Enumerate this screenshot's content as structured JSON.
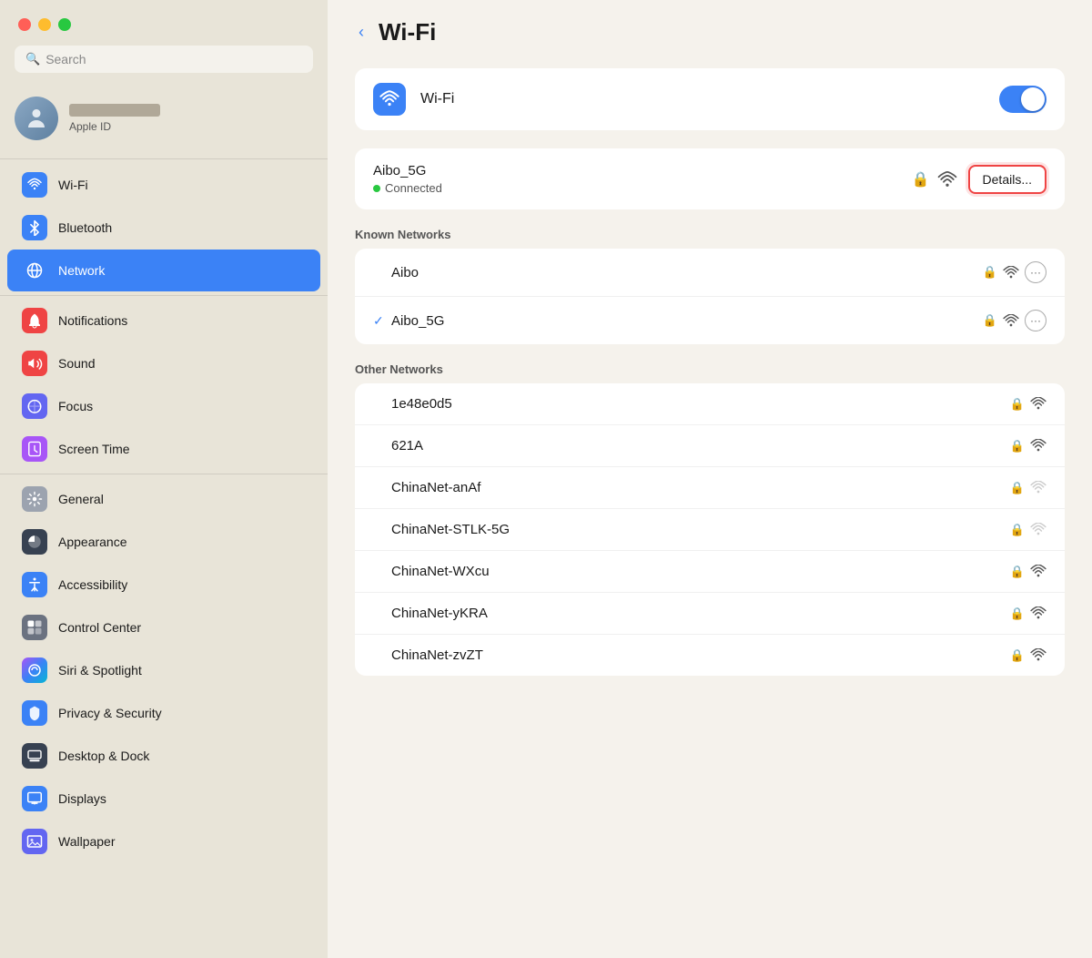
{
  "window": {
    "title": "Wi-Fi"
  },
  "window_controls": {
    "red_label": "close",
    "yellow_label": "minimize",
    "green_label": "maximize"
  },
  "sidebar": {
    "search_placeholder": "Search",
    "apple_id_label": "Apple ID",
    "items": [
      {
        "id": "wifi",
        "label": "Wi-Fi",
        "icon_type": "wifi",
        "active": false
      },
      {
        "id": "bluetooth",
        "label": "Bluetooth",
        "icon_type": "bluetooth",
        "active": false
      },
      {
        "id": "network",
        "label": "Network",
        "icon_type": "network",
        "active": true
      },
      {
        "id": "notifications",
        "label": "Notifications",
        "icon_type": "notifications",
        "active": false
      },
      {
        "id": "sound",
        "label": "Sound",
        "icon_type": "sound",
        "active": false
      },
      {
        "id": "focus",
        "label": "Focus",
        "icon_type": "focus",
        "active": false
      },
      {
        "id": "screentime",
        "label": "Screen Time",
        "icon_type": "screentime",
        "active": false
      },
      {
        "id": "general",
        "label": "General",
        "icon_type": "general",
        "active": false
      },
      {
        "id": "appearance",
        "label": "Appearance",
        "icon_type": "appearance",
        "active": false
      },
      {
        "id": "accessibility",
        "label": "Accessibility",
        "icon_type": "accessibility",
        "active": false
      },
      {
        "id": "controlcenter",
        "label": "Control Center",
        "icon_type": "controlcenter",
        "active": false
      },
      {
        "id": "siri",
        "label": "Siri & Spotlight",
        "icon_type": "siri",
        "active": false
      },
      {
        "id": "privacy",
        "label": "Privacy & Security",
        "icon_type": "privacy",
        "active": false
      },
      {
        "id": "desktopdock",
        "label": "Desktop & Dock",
        "icon_type": "desktopdock",
        "active": false
      },
      {
        "id": "displays",
        "label": "Displays",
        "icon_type": "displays",
        "active": false
      },
      {
        "id": "wallpaper",
        "label": "Wallpaper",
        "icon_type": "wallpaper",
        "active": false
      }
    ]
  },
  "main": {
    "back_button_label": "‹",
    "title": "Wi-Fi",
    "wifi_toggle_label": "Wi-Fi",
    "wifi_enabled": true,
    "connected_network": {
      "name": "Aibo_5G",
      "status": "Connected",
      "details_button": "Details..."
    },
    "known_networks_title": "Known Networks",
    "known_networks": [
      {
        "name": "Aibo",
        "has_check": false,
        "locked": true,
        "signal": "strong",
        "has_more": true
      },
      {
        "name": "Aibo_5G",
        "has_check": true,
        "locked": true,
        "signal": "strong",
        "has_more": true
      }
    ],
    "other_networks_title": "Other Networks",
    "other_networks": [
      {
        "name": "1e48e0d5",
        "locked": true,
        "signal": "strong"
      },
      {
        "name": "621A",
        "locked": true,
        "signal": "strong"
      },
      {
        "name": "ChinaNet-anAf",
        "locked": true,
        "signal": "weak"
      },
      {
        "name": "ChinaNet-STLK-5G",
        "locked": true,
        "signal": "weak"
      },
      {
        "name": "ChinaNet-WXcu",
        "locked": true,
        "signal": "strong"
      },
      {
        "name": "ChinaNet-yKRA",
        "locked": true,
        "signal": "strong"
      },
      {
        "name": "ChinaNet-zvZT",
        "locked": true,
        "signal": "strong"
      }
    ]
  }
}
